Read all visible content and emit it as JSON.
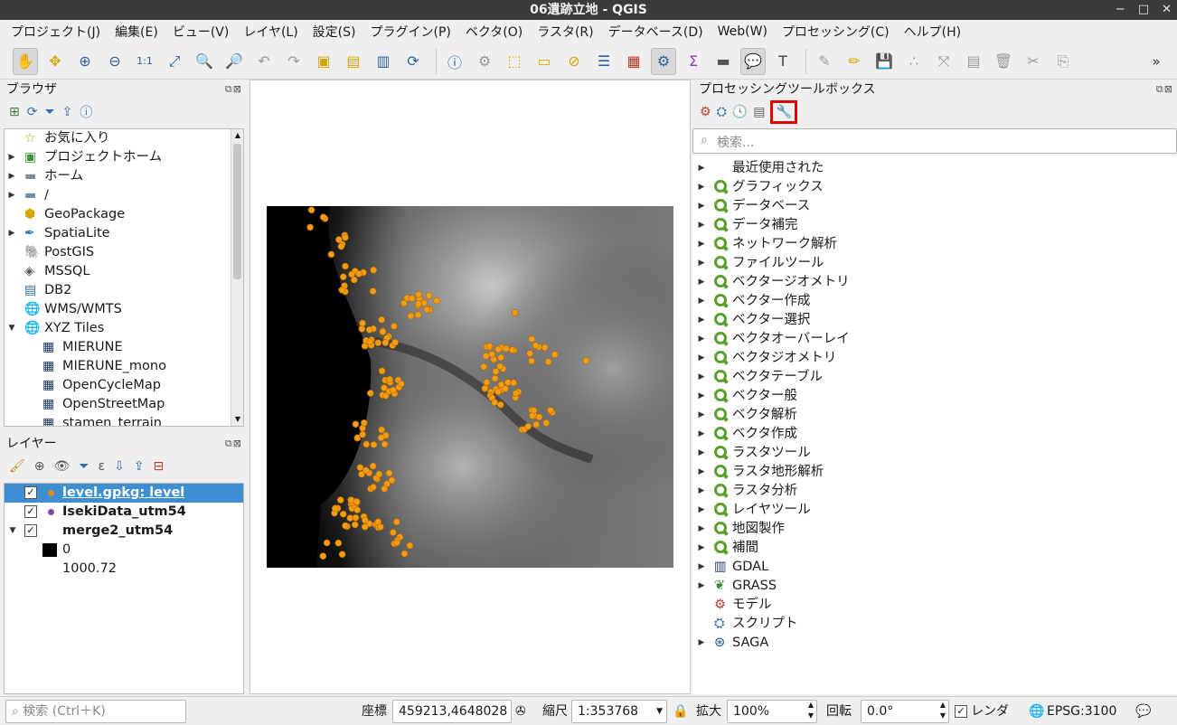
{
  "window": {
    "title": "06遺跡立地 - QGIS",
    "btn_min": "−",
    "btn_max": "□",
    "btn_close": "✕"
  },
  "menu": [
    "プロジェクト(J)",
    "編集(E)",
    "ビュー(V)",
    "レイヤ(L)",
    "設定(S)",
    "プラグイン(P)",
    "ベクタ(O)",
    "ラスタ(R)",
    "データベース(D)",
    "Web(W)",
    "プロセッシング(C)",
    "ヘルプ(H)"
  ],
  "toolbar_more": "»",
  "browser": {
    "title": "ブラウザ",
    "items": [
      {
        "label": "お気に入り",
        "icon": "star-icon",
        "arrow": ""
      },
      {
        "label": "プロジェクトホーム",
        "icon": "project-home-icon",
        "arrow": "▶"
      },
      {
        "label": "ホーム",
        "icon": "folder-icon",
        "arrow": "▶"
      },
      {
        "label": "/",
        "icon": "folder-icon",
        "arrow": "▶"
      },
      {
        "label": "GeoPackage",
        "icon": "geopackage-icon",
        "arrow": ""
      },
      {
        "label": "SpatiaLite",
        "icon": "spatialite-icon",
        "arrow": "▶"
      },
      {
        "label": "PostGIS",
        "icon": "postgis-icon",
        "arrow": ""
      },
      {
        "label": "MSSQL",
        "icon": "mssql-icon",
        "arrow": ""
      },
      {
        "label": "DB2",
        "icon": "db2-icon",
        "arrow": ""
      },
      {
        "label": "WMS/WMTS",
        "icon": "globe-icon",
        "arrow": ""
      },
      {
        "label": "XYZ Tiles",
        "icon": "globe-icon",
        "arrow": "▼"
      },
      {
        "label": "MIERUNE",
        "icon": "tiles-icon",
        "arrow": "",
        "indent": true
      },
      {
        "label": "MIERUNE_mono",
        "icon": "tiles-icon",
        "arrow": "",
        "indent": true
      },
      {
        "label": "OpenCycleMap",
        "icon": "tiles-icon",
        "arrow": "",
        "indent": true
      },
      {
        "label": "OpenStreetMap",
        "icon": "tiles-icon",
        "arrow": "",
        "indent": true
      },
      {
        "label": "stamen_terrain",
        "icon": "tiles-icon",
        "arrow": "",
        "indent": true
      }
    ]
  },
  "layers": {
    "title": "レイヤー",
    "items": [
      {
        "label": "level.gpkg: level",
        "checked": true,
        "selected": true,
        "dot": "#e08a1e"
      },
      {
        "label": "IsekiData_utm54",
        "checked": true,
        "selected": false,
        "dot": "#7b4fa0"
      },
      {
        "label": "merge2_utm54",
        "checked": true,
        "selected": false,
        "arrow": "▼"
      }
    ],
    "legend_min": "0",
    "legend_max": "1000.72"
  },
  "processing": {
    "title": "プロセッシングツールボックス",
    "search_placeholder": "検索...",
    "items": [
      {
        "label": "最近使用された",
        "icon": "none",
        "arrow": true
      },
      {
        "label": "グラフィックス",
        "icon": "qgis",
        "arrow": true
      },
      {
        "label": "データベース",
        "icon": "qgis",
        "arrow": true
      },
      {
        "label": "データ補完",
        "icon": "qgis",
        "arrow": true
      },
      {
        "label": "ネットワーク解析",
        "icon": "qgis",
        "arrow": true
      },
      {
        "label": "ファイルツール",
        "icon": "qgis",
        "arrow": true
      },
      {
        "label": "ベクタージオメトリ",
        "icon": "qgis",
        "arrow": true
      },
      {
        "label": "ベクター作成",
        "icon": "qgis",
        "arrow": true
      },
      {
        "label": "ベクター選択",
        "icon": "qgis",
        "arrow": true
      },
      {
        "label": "ベクタオーバーレイ",
        "icon": "qgis",
        "arrow": true
      },
      {
        "label": "ベクタジオメトリ",
        "icon": "qgis",
        "arrow": true
      },
      {
        "label": "ベクタテーブル",
        "icon": "qgis",
        "arrow": true
      },
      {
        "label": "ベクター般",
        "icon": "qgis",
        "arrow": true
      },
      {
        "label": "ベクタ解析",
        "icon": "qgis",
        "arrow": true
      },
      {
        "label": "ベクタ作成",
        "icon": "qgis",
        "arrow": true
      },
      {
        "label": "ラスタツール",
        "icon": "qgis",
        "arrow": true
      },
      {
        "label": "ラスタ地形解析",
        "icon": "qgis",
        "arrow": true
      },
      {
        "label": "ラスタ分析",
        "icon": "qgis",
        "arrow": true
      },
      {
        "label": "レイヤツール",
        "icon": "qgis",
        "arrow": true
      },
      {
        "label": "地図製作",
        "icon": "qgis",
        "arrow": true
      },
      {
        "label": "補間",
        "icon": "qgis",
        "arrow": true
      },
      {
        "label": "GDAL",
        "icon": "gdal",
        "arrow": true
      },
      {
        "label": "GRASS",
        "icon": "grass",
        "arrow": true
      },
      {
        "label": "モデル",
        "icon": "model",
        "arrow": false
      },
      {
        "label": "スクリプト",
        "icon": "python",
        "arrow": false
      },
      {
        "label": "SAGA",
        "icon": "saga",
        "arrow": true
      }
    ]
  },
  "status": {
    "search_placeholder": "検索 (Ctrl＋K)",
    "coord_label": "座標",
    "coord_value": "459213,4648028",
    "scale_label": "縮尺",
    "scale_value": "1:353768",
    "zoom_label": "拡大",
    "zoom_value": "100%",
    "rotation_label": "回転",
    "rotation_value": "0.0°",
    "render_label": "レンダ",
    "crs": "EPSG:3100"
  },
  "colors": {
    "accent": "#3d8fd1",
    "point": "#f39c12",
    "highlight": "#e00000"
  }
}
